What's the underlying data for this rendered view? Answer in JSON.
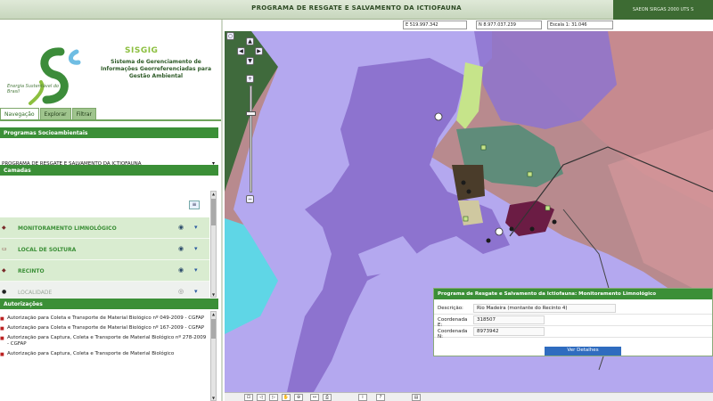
{
  "header": {
    "title": "PROGRAMA DE RESGATE E SALVAMENTO DA ICTIOFAUNA",
    "user": "SAEON SIRGAS 2000 UTS S"
  },
  "coords": {
    "e": "E 519.997.342",
    "n": "N 8.977.037.239",
    "scale": "Escala 1: 31.046"
  },
  "logo": {
    "brand": "Energia Sustentável do Brasil",
    "name": "SISGIG",
    "description": "Sistema de Gerenciamento de Informações Georreferenciadas para Gestão Ambiental",
    "accent": "#8cbf3f",
    "primary": "#2d5a27"
  },
  "tabs": [
    {
      "label": "Navegação",
      "active": true
    },
    {
      "label": "Explorar",
      "active": false
    },
    {
      "label": "Filtrar",
      "active": false
    }
  ],
  "programs": {
    "header": "Programas Socioambientais",
    "selected": "PROGRAMA DE RESGATE E SALVAMENTO DA ICTIOFAUNA"
  },
  "layers": {
    "header": "Camadas",
    "items": [
      {
        "label": "MONITORAMENTO LIMNOLÓGICO",
        "icon": "point-layer-icon",
        "dim": false
      },
      {
        "label": "LOCAL DE SOLTURA",
        "icon": "point-layer-icon",
        "dim": false
      },
      {
        "label": "RECINTO",
        "icon": "polygon-layer-icon",
        "dim": false
      },
      {
        "label": "LOCALIDADE",
        "icon": "point-layer-icon",
        "dim": true
      }
    ]
  },
  "authorizations": {
    "header": "Autorizações",
    "items": [
      "Autorização para Coleta e Transporte de Material Biológico nº 049-2009 - CGFAP",
      "Autorização para Coleta e Transporte de Material Biológico nº 167-2009 - CGFAP",
      "Autorização para Captura, Coleta e Transporte de Material Biológico nº 278-2009 - CGFAP",
      "Autorização para Captura, Coleta e Transporte de Material Biológico"
    ]
  },
  "popup": {
    "title": "Programa de Resgate e Salvamento da Ictiofauna: Monitoramento Limnológico",
    "fields": [
      {
        "label": "Descrição:",
        "value": "Rio Madeira (montante do Recinto 4)",
        "wide": true
      },
      {
        "label": "Coordenada E:",
        "value": "318507",
        "wide": false
      },
      {
        "label": "Coordenada N:",
        "value": "8973942",
        "wide": false
      }
    ],
    "button": "Ver Detalhes"
  },
  "colors": {
    "green_header": "#3b8f37",
    "water": "#b4a8ef",
    "reservoir": "#8d73cf",
    "land": "#b88a8e"
  }
}
